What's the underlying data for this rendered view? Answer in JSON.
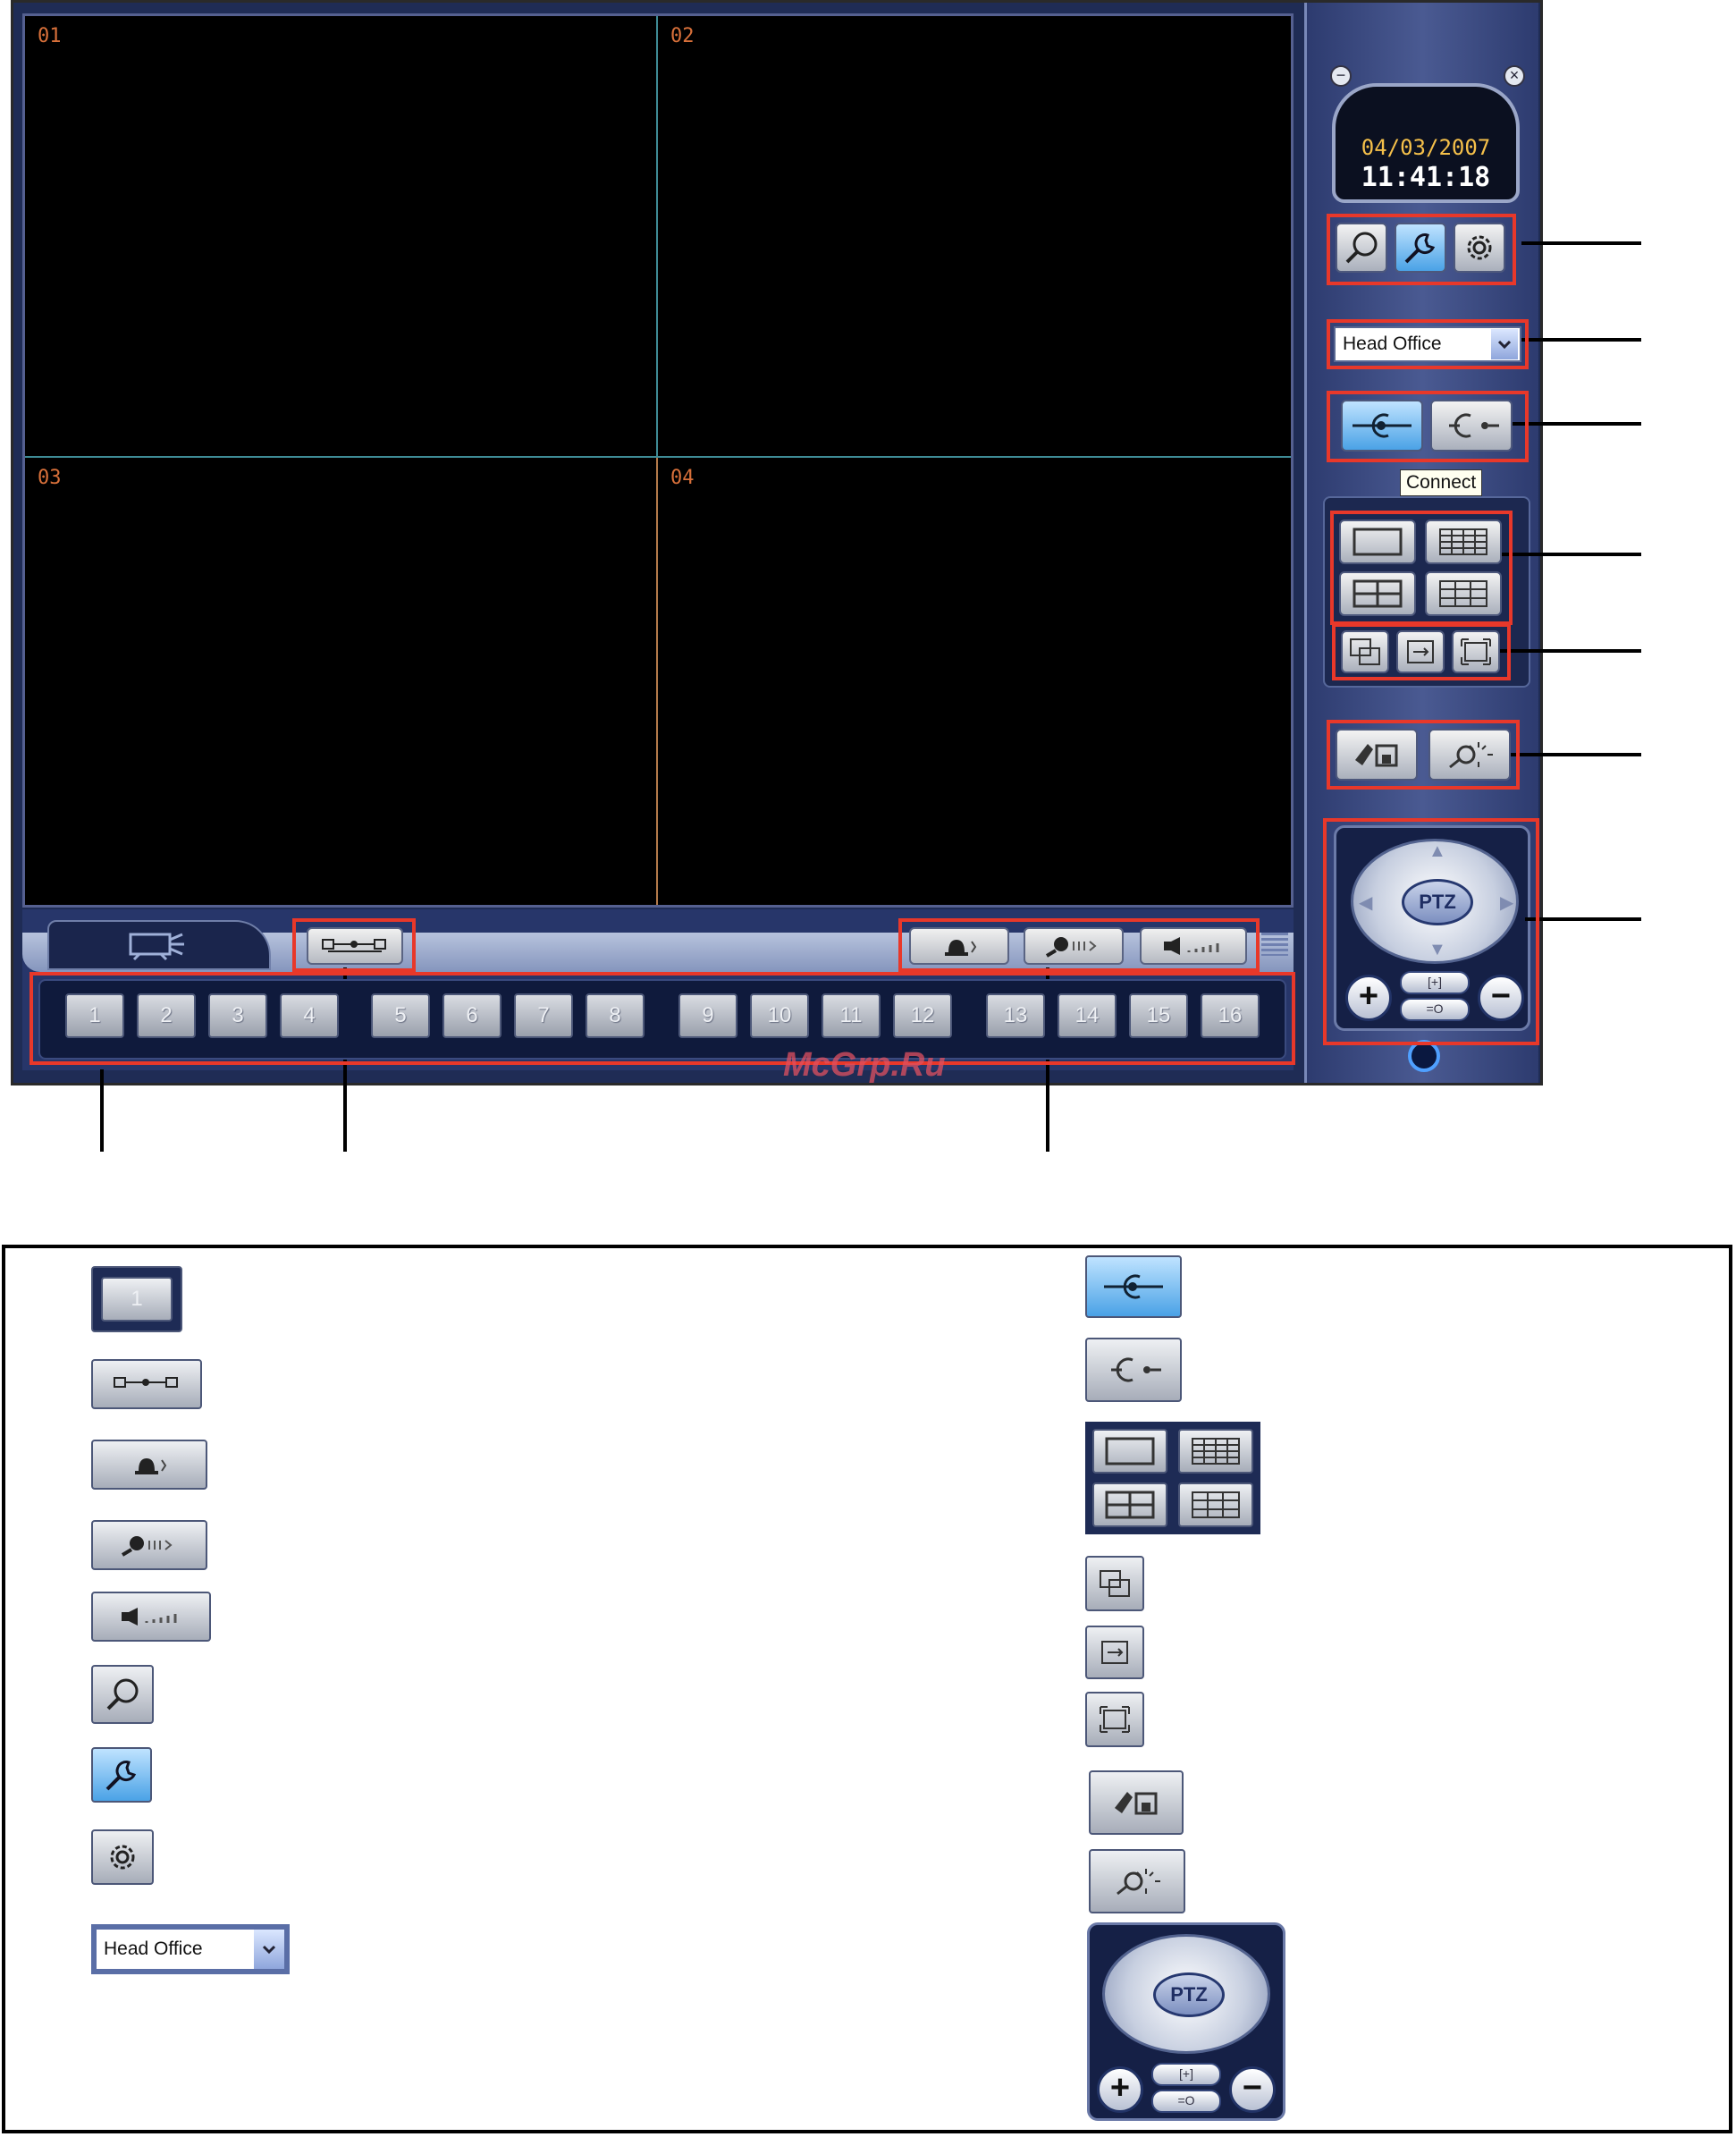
{
  "video": {
    "cells": [
      "01",
      "02",
      "03",
      "04"
    ]
  },
  "channels": [
    "1",
    "2",
    "3",
    "4",
    "5",
    "6",
    "7",
    "8",
    "9",
    "10",
    "11",
    "12",
    "13",
    "14",
    "15",
    "16"
  ],
  "clock": {
    "date": "04/03/2007",
    "time": "11:41:18"
  },
  "site_select": {
    "value": "Head Office"
  },
  "tooltip": "Connect",
  "ptz": {
    "label": "PTZ"
  },
  "zoom": {
    "plus": "+",
    "minus": "−"
  },
  "watermark": "McGrp.Ru",
  "legend": {
    "channel_sample": "1",
    "site_select_value": "Head Office",
    "ptz_label": "PTZ"
  },
  "icons": {
    "search": "search-icon",
    "tools": "tools-icon",
    "settings": "gear-icon",
    "connect": "connect-icon",
    "disconnect": "disconnect-icon",
    "sequence": "sequence-icon",
    "alarm": "alarm-icon",
    "microphone": "microphone-icon",
    "speaker": "speaker-icon",
    "save": "save-icon",
    "image_adjust": "image-adjust-icon",
    "power": "power-icon"
  },
  "colors": {
    "highlight": "#e8382a",
    "panel": "#1f2c55",
    "clock_date": "#f5c04a",
    "connect_active": "#4aa2e6"
  }
}
